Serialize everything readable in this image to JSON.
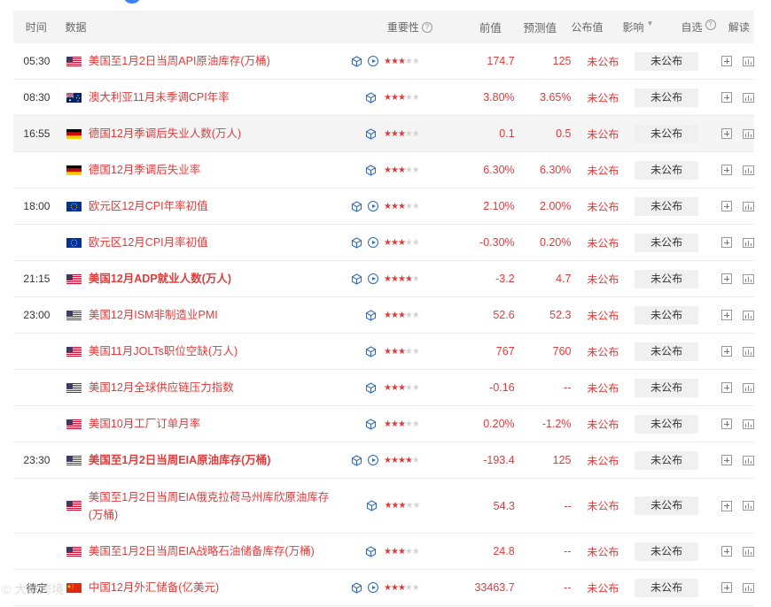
{
  "header": {
    "time": "时间",
    "data": "数据",
    "importance": "重要性",
    "prev": "前值",
    "forecast": "预测值",
    "published": "公布值",
    "impact": "影响",
    "favorite": "自选",
    "read": "解读"
  },
  "colors": {
    "accent": "#e13b3b",
    "icon_blue": "#2c6bb9"
  },
  "rows": [
    {
      "time": "05:30",
      "flag": "us",
      "title": "美国至1月2日当周API原油库存(万桶)",
      "bold": false,
      "icons": [
        "3d",
        "play"
      ],
      "stars": 3,
      "prev": "174.7",
      "forecast": "125",
      "published": "未公布",
      "impact": "未公布"
    },
    {
      "time": "08:30",
      "flag": "au",
      "title": "澳大利亚11月未季调CPI年率",
      "bold": false,
      "icons": [
        "3d"
      ],
      "stars": 3,
      "prev": "3.80%",
      "forecast": "3.65%",
      "published": "未公布",
      "impact": "未公布"
    },
    {
      "time": "16:55",
      "flag": "de",
      "title": "德国12月季调后失业人数(万人)",
      "bold": false,
      "icons": [
        "3d"
      ],
      "stars": 3,
      "prev": "0.1",
      "forecast": "0.5",
      "published": "未公布",
      "impact": "未公布",
      "highlight": true
    },
    {
      "time": "",
      "flag": "de",
      "title": "德国12月季调后失业率",
      "bold": false,
      "icons": [
        "3d"
      ],
      "stars": 3,
      "prev": "6.30%",
      "forecast": "6.30%",
      "published": "未公布",
      "impact": "未公布"
    },
    {
      "time": "18:00",
      "flag": "eu",
      "title": "欧元区12月CPI年率初值",
      "bold": false,
      "icons": [
        "3d",
        "play"
      ],
      "stars": 3,
      "prev": "2.10%",
      "forecast": "2.00%",
      "published": "未公布",
      "impact": "未公布"
    },
    {
      "time": "",
      "flag": "eu",
      "title": "欧元区12月CPI月率初值",
      "bold": false,
      "icons": [
        "3d",
        "play"
      ],
      "stars": 3,
      "prev": "-0.30%",
      "forecast": "0.20%",
      "published": "未公布",
      "impact": "未公布"
    },
    {
      "time": "21:15",
      "flag": "us",
      "title": "美国12月ADP就业人数(万人)",
      "bold": true,
      "icons": [
        "3d",
        "play"
      ],
      "stars": 4,
      "prev": "-3.2",
      "forecast": "4.7",
      "published": "未公布",
      "impact": "未公布"
    },
    {
      "time": "23:00",
      "flag": "us",
      "title": "美国12月ISM非制造业PMI",
      "bold": false,
      "icons": [
        "3d"
      ],
      "stars": 3,
      "prev": "52.6",
      "forecast": "52.3",
      "published": "未公布",
      "impact": "未公布"
    },
    {
      "time": "",
      "flag": "us",
      "title": "美国11月JOLTs职位空缺(万人)",
      "bold": false,
      "icons": [
        "3d"
      ],
      "stars": 3,
      "prev": "767",
      "forecast": "760",
      "published": "未公布",
      "impact": "未公布"
    },
    {
      "time": "",
      "flag": "us",
      "title": "美国12月全球供应链压力指数",
      "bold": false,
      "icons": [
        "3d"
      ],
      "stars": 3,
      "prev": "-0.16",
      "forecast": "--",
      "published": "未公布",
      "impact": "未公布"
    },
    {
      "time": "",
      "flag": "us",
      "title": "美国10月工厂订单月率",
      "bold": false,
      "icons": [
        "3d"
      ],
      "stars": 3,
      "prev": "0.20%",
      "forecast": "-1.2%",
      "published": "未公布",
      "impact": "未公布"
    },
    {
      "time": "23:30",
      "flag": "us",
      "title": "美国至1月2日当周EIA原油库存(万桶)",
      "bold": true,
      "icons": [
        "3d",
        "play"
      ],
      "stars": 4,
      "prev": "-193.4",
      "forecast": "125",
      "published": "未公布",
      "impact": "未公布"
    },
    {
      "time": "",
      "flag": "us",
      "title": "美国至1月2日当周EIA俄克拉荷马州库欣原油库存(万桶)",
      "bold": false,
      "icons": [
        "3d"
      ],
      "stars": 3,
      "prev": "54.3",
      "forecast": "--",
      "published": "未公布",
      "impact": "未公布",
      "tall": true
    },
    {
      "time": "",
      "flag": "us",
      "title": "美国至1月2日当周EIA战略石油储备库存(万桶)",
      "bold": false,
      "icons": [
        "3d"
      ],
      "stars": 3,
      "prev": "24.8",
      "forecast": "--",
      "published": "未公布",
      "impact": "未公布"
    },
    {
      "time": "待定",
      "flag": "cn",
      "title": "中国12月外汇储备(亿美元)",
      "bold": false,
      "icons": [
        "3d",
        "play"
      ],
      "stars": 3,
      "prev": "33463.7",
      "forecast": "--",
      "published": "未公布",
      "impact": "未公布"
    }
  ],
  "watermark": "© 大数跨境"
}
